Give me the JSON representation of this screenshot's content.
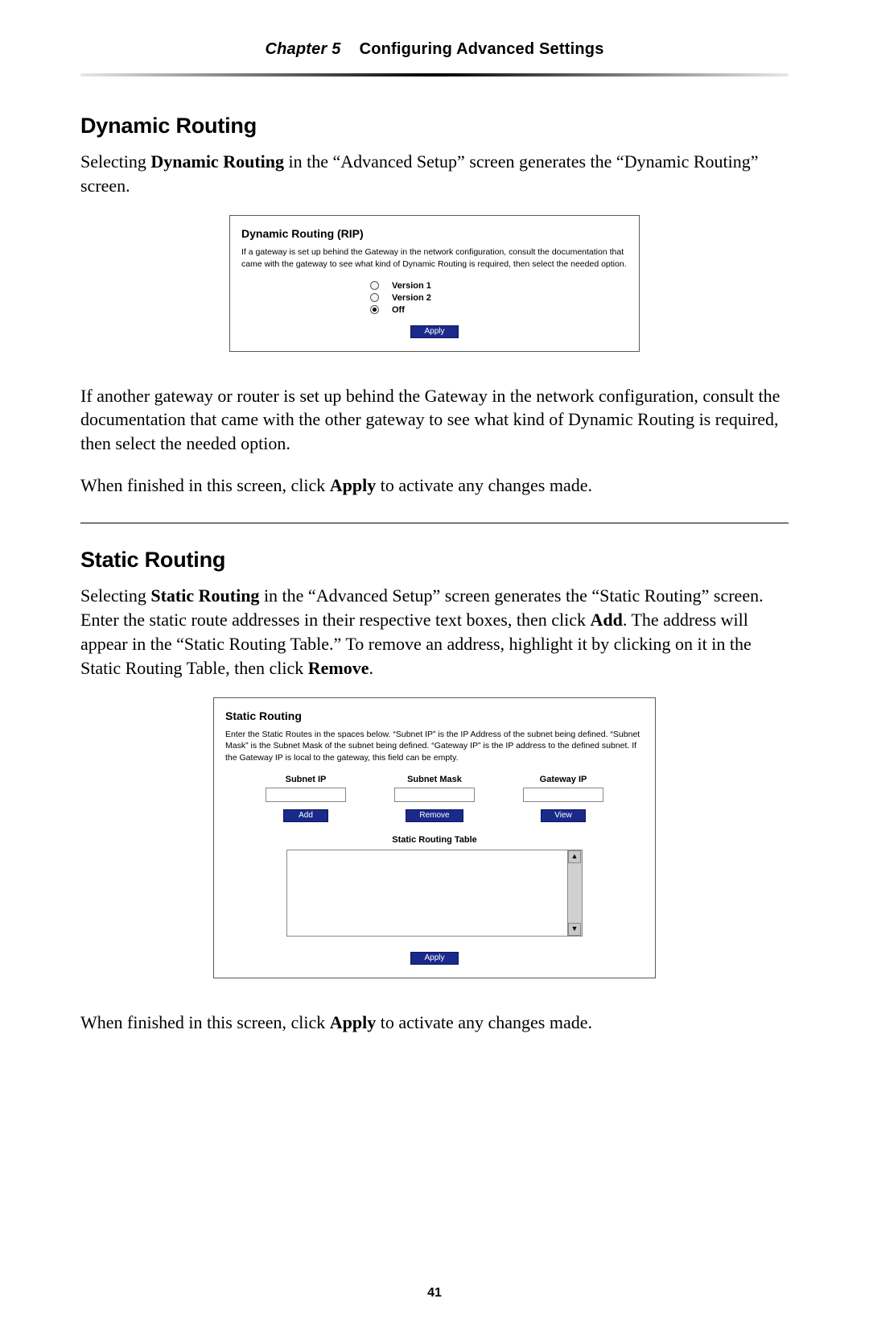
{
  "header": {
    "chapter_label": "Chapter 5",
    "chapter_title": "Configuring Advanced Settings"
  },
  "section_dynamic": {
    "heading": "Dynamic Routing",
    "intro_pre": "Selecting ",
    "intro_bold": "Dynamic Routing",
    "intro_post": " in the “Advanced Setup” screen generates the “Dynamic Routing” screen.",
    "shot": {
      "title": "Dynamic Routing (RIP)",
      "desc": "If a gateway is set up behind the Gateway in the network configuration, consult the documentation that came with the gateway to see what kind of Dynamic Routing is required, then select the needed option.",
      "options": [
        "Version 1",
        "Version 2",
        "Off"
      ],
      "selected_index": 2,
      "apply_label": "Apply"
    },
    "para2": "If another gateway or router is set up behind the Gateway in the network configuration, consult the documentation that came with the other gateway to see what kind of Dynamic Routing is required, then select the needed option.",
    "para3_pre": "When finished in this screen, click ",
    "para3_bold": "Apply",
    "para3_post": " to activate any changes made."
  },
  "section_static": {
    "heading": "Static Routing",
    "intro_pre": "Selecting ",
    "intro_bold1": "Static Routing",
    "intro_mid1": " in the “Advanced Setup” screen generates the “Static Routing” screen. Enter the static route addresses in their respective text boxes, then click ",
    "intro_bold2": "Add",
    "intro_mid2": ". The address will appear in the “Static Routing Table.” To remove an address, highlight it by clicking on it in the Static Routing Table, then click ",
    "intro_bold3": "Remove",
    "intro_post": ".",
    "shot": {
      "title": "Static Routing",
      "desc": "Enter the Static Routes in the spaces below. “Subnet IP” is the IP Address of the subnet being defined. “Subnet Mask” is the Subnet Mask of the subnet being defined. “Gateway IP” is the IP address to the defined subnet. If the Gateway IP is local to the gateway, this field can be empty.",
      "cols": [
        {
          "head": "Subnet IP",
          "btn": "Add"
        },
        {
          "head": "Subnet Mask",
          "btn": "Remove"
        },
        {
          "head": "Gateway IP",
          "btn": "View"
        }
      ],
      "table_title": "Static Routing Table",
      "apply_label": "Apply"
    },
    "outro_pre": "When finished in this screen, click ",
    "outro_bold": "Apply",
    "outro_post": " to activate any changes made."
  },
  "page_number": "41"
}
